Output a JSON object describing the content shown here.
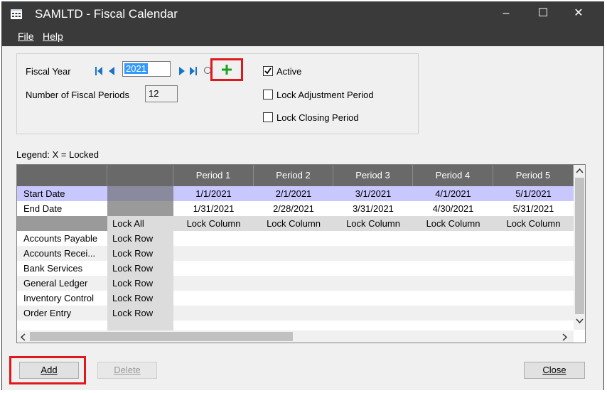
{
  "window": {
    "title": "SAMLTD - Fiscal Calendar",
    "controls": {
      "minimize": "‒",
      "maximize": "☐",
      "close": "✕"
    }
  },
  "menu": {
    "file": "File",
    "help": "Help"
  },
  "fiscal": {
    "year_label": "Fiscal Year",
    "year_value": "2021",
    "periods_label": "Number of Fiscal Periods",
    "periods_value": "12"
  },
  "options": {
    "active": {
      "label": "Active",
      "checked": true
    },
    "lock_adjustment": {
      "label": "Lock Adjustment Period",
      "checked": false
    },
    "lock_closing": {
      "label": "Lock Closing Period",
      "checked": false
    }
  },
  "legend": "Legend: X = Locked",
  "grid": {
    "periods": [
      {
        "header": "Period 1",
        "start": "1/1/2021",
        "end": "1/31/2021",
        "lock": "Lock Column"
      },
      {
        "header": "Period 2",
        "start": "2/1/2021",
        "end": "2/28/2021",
        "lock": "Lock Column"
      },
      {
        "header": "Period 3",
        "start": "3/1/2021",
        "end": "3/31/2021",
        "lock": "Lock Column"
      },
      {
        "header": "Period 4",
        "start": "4/1/2021",
        "end": "4/30/2021",
        "lock": "Lock Column"
      },
      {
        "header": "Period 5",
        "start": "5/1/2021",
        "end": "5/31/2021",
        "lock": "Lock Column"
      }
    ],
    "start_label": "Start Date",
    "end_label": "End Date",
    "lock_all": "Lock All",
    "modules": [
      {
        "name": "Accounts Payable",
        "lock": "Lock Row"
      },
      {
        "name": "Accounts Recei...",
        "lock": "Lock Row"
      },
      {
        "name": "Bank Services",
        "lock": "Lock Row"
      },
      {
        "name": "General Ledger",
        "lock": "Lock Row"
      },
      {
        "name": "Inventory Control",
        "lock": "Lock Row"
      },
      {
        "name": "Order Entry",
        "lock": "Lock Row"
      }
    ]
  },
  "buttons": {
    "add": "Add",
    "delete": "Delete",
    "close": "Close"
  },
  "colors": {
    "titlebar": "#3a3a3a",
    "grid_header": "#696969",
    "selected_row": "#c8c8ff",
    "highlight_box": "#e0181b",
    "add_icon": "#20a020"
  }
}
